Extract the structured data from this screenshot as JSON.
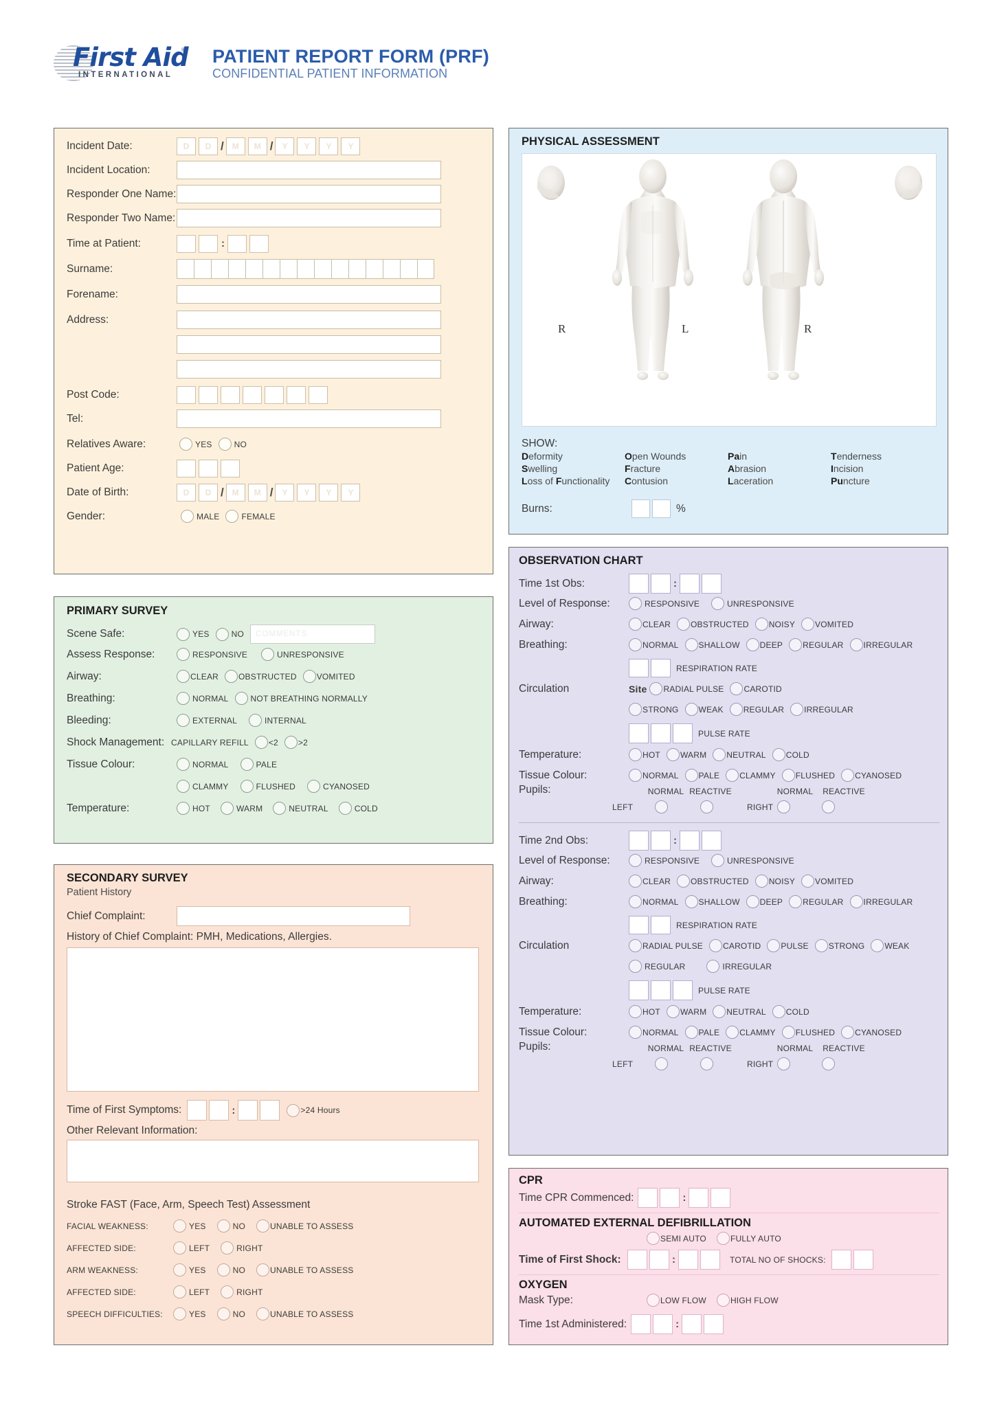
{
  "header": {
    "logo_name": "First Aid",
    "logo_sub": "INTERNATIONAL",
    "logo_tm": "®",
    "title": "PATIENT REPORT FORM (PRF)",
    "subtitle": "CONFIDENTIAL PATIENT INFORMATION"
  },
  "incident": {
    "labels": {
      "incident_date": "Incident Date:",
      "incident_location": "Incident Location:",
      "responder_one": "Responder One Name:",
      "responder_two": "Responder Two Name:",
      "time_at_patient": "Time at Patient:",
      "surname": "Surname:",
      "forename": "Forename:",
      "address": "Address:",
      "post_code": "Post Code:",
      "tel": "Tel:",
      "relatives_aware": "Relatives Aware:",
      "patient_age": "Patient Age:",
      "date_of_birth": "Date of Birth:",
      "gender": "Gender:"
    },
    "date_placeholder": [
      "D",
      "D",
      "M",
      "M",
      "Y",
      "Y",
      "Y",
      "Y"
    ],
    "relatives_options": [
      "YES",
      "NO"
    ],
    "gender_options": [
      "MALE",
      "FEMALE"
    ],
    "separator": "/",
    "colon": ":"
  },
  "primary": {
    "title": "PRIMARY SURVEY",
    "rows": [
      {
        "label": "Scene Safe:",
        "options": [
          "YES",
          "NO"
        ],
        "comment_placeholder": "COMMENTS"
      },
      {
        "label": "Assess Response:",
        "options": [
          "RESPONSIVE",
          "UNRESPONSIVE"
        ]
      },
      {
        "label": "Airway:",
        "options": [
          "CLEAR",
          "OBSTRUCTED",
          "VOMITED"
        ]
      },
      {
        "label": "Breathing:",
        "options": [
          "NORMAL",
          "NOT BREATHING NORMALLY"
        ]
      },
      {
        "label": "Bleeding:",
        "options": [
          "EXTERNAL",
          "INTERNAL"
        ]
      },
      {
        "label": "Shock Management:",
        "prefix": "CAPILLARY REFILL",
        "options": [
          "<2",
          ">2"
        ]
      },
      {
        "label": "Tissue Colour:",
        "options": [
          "NORMAL",
          "PALE"
        ]
      },
      {
        "label": "",
        "options": [
          "CLAMMY",
          "FLUSHED",
          "CYANOSED"
        ]
      },
      {
        "label": "Temperature:",
        "options": [
          "HOT",
          "WARM",
          "NEUTRAL",
          "COLD"
        ]
      }
    ]
  },
  "secondary": {
    "title": "SECONDARY SURVEY",
    "subtitle": "Patient History",
    "chief_complaint_label": "Chief Complaint:",
    "history_label": "History of Chief Complaint: PMH, Medications, Allergies.",
    "time_first_symptoms_label": "Time of First Symptoms:",
    "over24_label": ">24 Hours",
    "other_info_label": "Other Relevant Information:",
    "stroke_title": "Stroke FAST (Face, Arm, Speech Test) Assessment",
    "stroke_rows": [
      {
        "label": "FACIAL WEAKNESS:",
        "options": [
          "YES",
          "NO",
          "UNABLE TO ASSESS"
        ]
      },
      {
        "label": "AFFECTED SIDE:",
        "options": [
          "LEFT",
          "RIGHT"
        ]
      },
      {
        "label": "ARM WEAKNESS:",
        "options": [
          "YES",
          "NO",
          "UNABLE TO ASSESS"
        ]
      },
      {
        "label": "AFFECTED SIDE:",
        "options": [
          "LEFT",
          "RIGHT"
        ]
      },
      {
        "label": "SPEECH DIFFICULTIES:",
        "options": [
          "YES",
          "NO",
          "UNABLE TO ASSESS"
        ]
      }
    ]
  },
  "physical": {
    "title": "PHYSICAL ASSESSMENT",
    "body_labels": [
      "R",
      "L",
      "R"
    ],
    "show_head": "SHOW:",
    "show_columns": [
      [
        {
          "bold": "D",
          "rest": "eformity"
        },
        {
          "bold": "S",
          "rest": "welling"
        },
        {
          "bold": "L",
          "rest": "oss of ",
          "bold2": "F",
          "rest2": "unctionality"
        }
      ],
      [
        {
          "bold": "O",
          "rest": "pen Wounds"
        },
        {
          "bold": "F",
          "rest": "racture"
        },
        {
          "bold": "C",
          "rest": "ontusion"
        }
      ],
      [
        {
          "bold": "Pa",
          "rest": "in"
        },
        {
          "bold": "A",
          "rest": "brasion"
        },
        {
          "bold": "L",
          "rest": "aceration"
        }
      ],
      [
        {
          "bold": "T",
          "rest": "enderness"
        },
        {
          "bold": "I",
          "rest": "ncision"
        },
        {
          "bold": "Pu",
          "rest": "ncture"
        }
      ]
    ],
    "burns_label": "Burns:",
    "burns_unit": "%"
  },
  "observation": {
    "title": "OBSERVATION CHART",
    "block1": {
      "time_label": "Time 1st Obs:",
      "rows": [
        {
          "label": "Level of Response:",
          "options": [
            "RESPONSIVE",
            "UNRESPONSIVE"
          ]
        },
        {
          "label": "Airway:",
          "options": [
            "CLEAR",
            "OBSTRUCTED",
            "NOISY",
            "VOMITED"
          ]
        },
        {
          "label": "Breathing:",
          "options": [
            "NORMAL",
            "SHALLOW",
            "DEEP",
            "REGULAR",
            "IRREGULAR"
          ]
        }
      ],
      "respiration_rate_label": "RESPIRATION RATE",
      "circulation_label": "Circulation",
      "site_label": "Site",
      "site_options": [
        "RADIAL PULSE",
        "CAROTID"
      ],
      "strength_options": [
        "STRONG",
        "WEAK",
        "REGULAR",
        "IRREGULAR"
      ],
      "pulse_rate_label": "PULSE RATE",
      "temperature_label": "Temperature:",
      "temperature_options": [
        "HOT",
        "WARM",
        "NEUTRAL",
        "COLD"
      ],
      "tissue_label": "Tissue Colour:",
      "tissue_options": [
        "NORMAL",
        "PALE",
        "CLAMMY",
        "FLUSHED",
        "CYANOSED"
      ],
      "pupils_label": "Pupils:",
      "pupil_headers": [
        "NORMAL",
        "REACTIVE"
      ],
      "pupil_sides": [
        "LEFT",
        "RIGHT"
      ]
    },
    "block2": {
      "time_label": "Time 2nd Obs:",
      "rows": [
        {
          "label": "Level of Response:",
          "options": [
            "RESPONSIVE",
            "UNRESPONSIVE"
          ]
        },
        {
          "label": "Airway:",
          "options": [
            "CLEAR",
            "OBSTRUCTED",
            "NOISY",
            "VOMITED"
          ]
        },
        {
          "label": "Breathing:",
          "options": [
            "NORMAL",
            "SHALLOW",
            "DEEP",
            "REGULAR",
            "IRREGULAR"
          ]
        }
      ],
      "respiration_rate_label": "RESPIRATION RATE",
      "circulation_label": "Circulation",
      "circulation_options_r1": [
        "RADIAL PULSE",
        "CAROTID",
        "PULSE",
        "STRONG",
        "WEAK"
      ],
      "circulation_options_r2": [
        "REGULAR",
        "IRREGULAR"
      ],
      "pulse_rate_label": "PULSE RATE",
      "temperature_label": "Temperature:",
      "temperature_options": [
        "HOT",
        "WARM",
        "NEUTRAL",
        "COLD"
      ],
      "tissue_label": "Tissue Colour:",
      "tissue_options": [
        "NORMAL",
        "PALE",
        "CLAMMY",
        "FLUSHED",
        "CYANOSED"
      ],
      "pupils_label": "Pupils:",
      "pupil_headers": [
        "NORMAL",
        "REACTIVE"
      ],
      "pupil_sides": [
        "LEFT",
        "RIGHT"
      ]
    }
  },
  "cpr": {
    "title": "CPR",
    "time_commenced_label": "Time CPR Commenced:",
    "aed_title": "AUTOMATED EXTERNAL DEFIBRILLATION",
    "aed_options": [
      "SEMI AUTO",
      "FULLY AUTO"
    ],
    "first_shock_label": "Time of First Shock:",
    "total_shocks_label": "TOTAL NO OF SHOCKS:",
    "oxygen_title": "OXYGEN",
    "mask_type_label": "Mask Type:",
    "mask_options": [
      "LOW FLOW",
      "HIGH FLOW"
    ],
    "time_administered_label": "Time 1st Administered:"
  }
}
